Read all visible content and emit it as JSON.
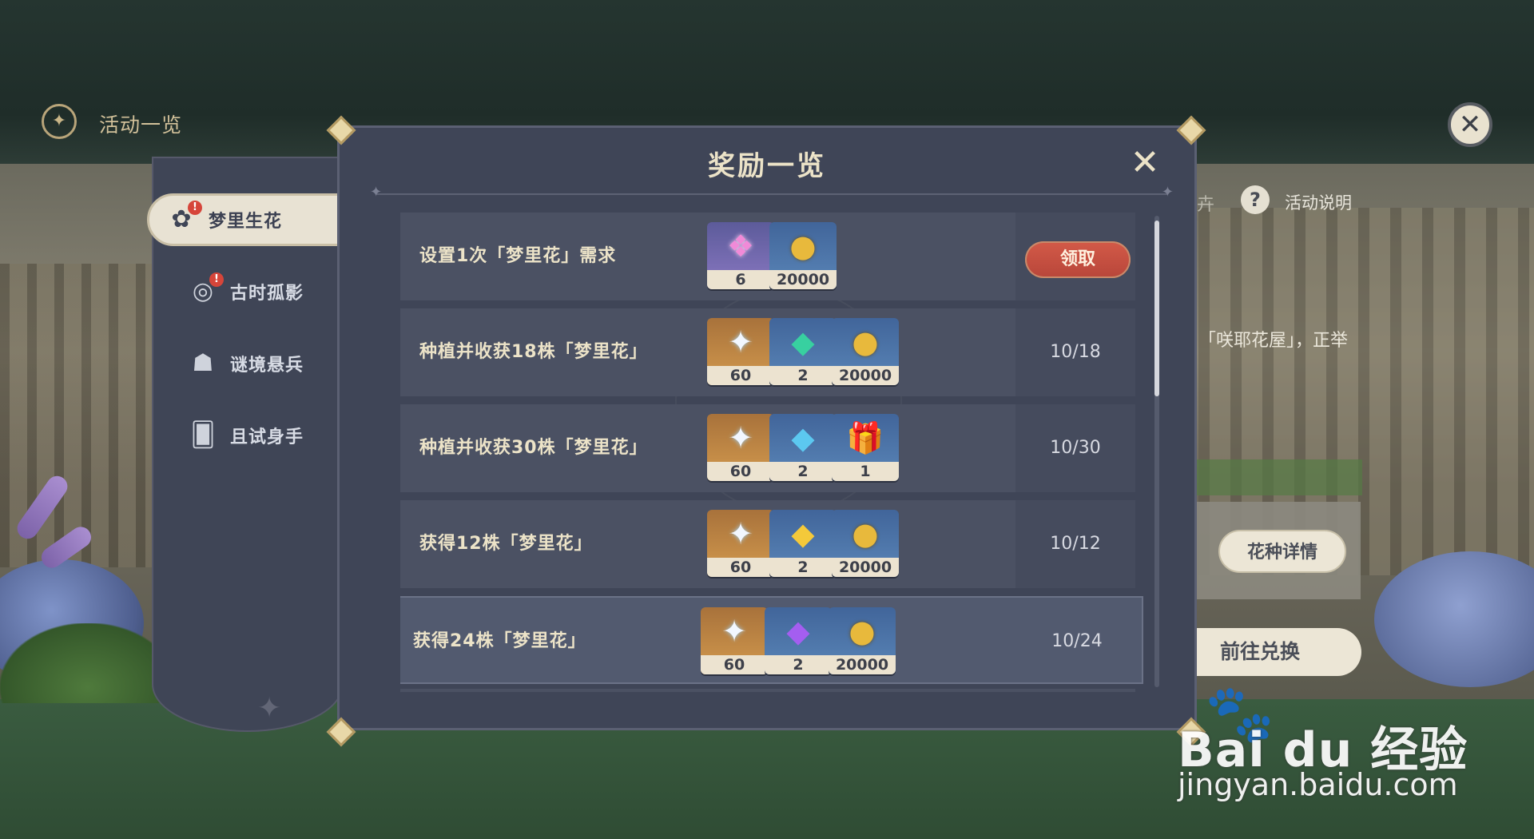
{
  "header": {
    "title": "活动一览"
  },
  "sidebar": {
    "items": [
      {
        "label": "梦里生花",
        "icon": "flower-pot-icon",
        "badge": "!"
      },
      {
        "label": "古时孤影",
        "icon": "pocket-watch-icon",
        "badge": "!"
      },
      {
        "label": "谜境悬兵",
        "icon": "cat-mask-icon"
      },
      {
        "label": "且试身手",
        "icon": "cards-icon"
      }
    ]
  },
  "background_panel": {
    "tab_partial": "卉",
    "help_label": "活动说明",
    "desc_partial": "「咲耶花屋」，正举",
    "flower_details_button": "花种详情",
    "exchange_button": "前往兑换"
  },
  "dialog": {
    "title": "奖励一览",
    "rows": [
      {
        "task": "设置1次「梦里花」需求",
        "status": "claim",
        "claim_label": "领取",
        "rewards": [
          {
            "kind": "crystal",
            "quality": "purple",
            "qty": "6"
          },
          {
            "kind": "mora",
            "quality": "blue",
            "qty": "20000"
          }
        ]
      },
      {
        "task": "种植并收获18株「梦里花」",
        "progress": "10/18",
        "rewards": [
          {
            "kind": "primogem",
            "quality": "gold",
            "qty": "60"
          },
          {
            "kind": "gem-green",
            "quality": "blue",
            "qty": "2"
          },
          {
            "kind": "mora",
            "quality": "blue",
            "qty": "20000"
          }
        ]
      },
      {
        "task": "种植并收获30株「梦里花」",
        "progress": "10/30",
        "rewards": [
          {
            "kind": "primogem",
            "quality": "gold",
            "qty": "60"
          },
          {
            "kind": "gem-blue",
            "quality": "blue",
            "qty": "2"
          },
          {
            "kind": "gift",
            "quality": "blue",
            "qty": "1"
          }
        ]
      },
      {
        "task": "获得12株「梦里花」",
        "progress": "10/12",
        "rewards": [
          {
            "kind": "primogem",
            "quality": "gold",
            "qty": "60"
          },
          {
            "kind": "gem-yellow",
            "quality": "blue",
            "qty": "2"
          },
          {
            "kind": "mora",
            "quality": "blue",
            "qty": "20000"
          }
        ]
      },
      {
        "task": "获得24株「梦里花」",
        "progress": "10/24",
        "rewards": [
          {
            "kind": "primogem",
            "quality": "gold",
            "qty": "60"
          },
          {
            "kind": "gem-purple",
            "quality": "blue",
            "qty": "2"
          },
          {
            "kind": "mora",
            "quality": "blue",
            "qty": "20000"
          }
        ]
      }
    ]
  },
  "watermark": {
    "logo": "Bai du 经验",
    "url": "jingyan.baidu.com"
  },
  "colors": {
    "claim_button": "#c8503f",
    "dialog_bg": "#3f4557",
    "title_text": "#ece3c8"
  }
}
